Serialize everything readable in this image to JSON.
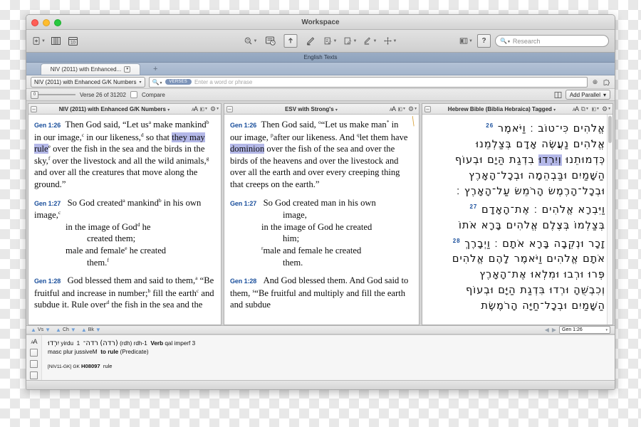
{
  "window": {
    "title": "Workspace",
    "traffic_lights": [
      "close",
      "minimize",
      "zoom"
    ]
  },
  "toolbar": {
    "left_icons": [
      "new-document-icon",
      "library-icon",
      "calendar-icon"
    ],
    "mid_icons": [
      "search-all-icon",
      "timeline-icon",
      "export-icon",
      "highlighter-icon",
      "notes-icon",
      "user-notes-icon",
      "edit-tool-icon",
      "move-icon"
    ],
    "right_icons": [
      "layout-icon",
      "help-icon"
    ],
    "research_placeholder": "Research",
    "magnifier": "search-icon"
  },
  "workspace": {
    "header_label": "English Texts",
    "tabs": [
      {
        "label": "NIV (2011) with Enhanced...",
        "has_menu": true
      }
    ],
    "add_tab_label": "+"
  },
  "search": {
    "corpus_label": "NIV (2011) with Enhanced G/K Numbers",
    "corpus_caret": "▾",
    "mode_pill": "VERSES",
    "placeholder": "Enter a word or phrase",
    "add_icon": "plus-circle-icon",
    "puzzle_icon": "puzzle-icon"
  },
  "verse_row": {
    "slider_value": "0",
    "verse_count_label": "Verse 26 of 31202",
    "compare_label": "Compare",
    "parallel_icon": "parallel-pane-icon",
    "add_parallel_label": "Add Parallel",
    "add_parallel_caret": "▾"
  },
  "panes": [
    {
      "id": "niv",
      "title": "NIV (2011) with Enhanced G/K Numbers",
      "title_caret": "▾",
      "tools": [
        "text-size-icon",
        "display-icon",
        "settings-icon"
      ],
      "verses": [
        {
          "ref": "Gen 1:26",
          "segments": [
            {
              "t": "Then God said, “Let us"
            },
            {
              "t": "a",
              "note": true
            },
            {
              "t": " make mankind"
            },
            {
              "t": "b",
              "note": true
            },
            {
              "t": " in our image,"
            },
            {
              "t": "c",
              "note": true
            },
            {
              "t": " in our likeness,"
            },
            {
              "t": "d",
              "note": true
            },
            {
              "t": " so that "
            },
            {
              "t": "they may rule",
              "hl": true
            },
            {
              "t": "e",
              "note": true
            },
            {
              "t": " over the fish in the sea and the birds in the sky,"
            },
            {
              "t": "f",
              "note": true
            },
            {
              "t": " over the livestock and all the wild animals,"
            },
            {
              "t": "g",
              "note": true
            },
            {
              "t": " and over all the creatures that move along the ground.”"
            }
          ]
        },
        {
          "ref": "Gen 1:27",
          "segments": [
            {
              "t": "So God created"
            },
            {
              "t": "a",
              "note": true
            },
            {
              "t": " mankind"
            },
            {
              "t": "b",
              "note": true
            },
            {
              "t": " in his own image,"
            },
            {
              "t": "c",
              "note": true
            },
            {
              "t": "in the image of God",
              "indent": 1
            },
            {
              "t": "d",
              "note": true
            },
            {
              "t": " he"
            },
            {
              "t": "created them;",
              "indent": 2
            },
            {
              "t": "male and female",
              "indent": 1
            },
            {
              "t": "e",
              "note": true
            },
            {
              "t": " he created"
            },
            {
              "t": "them.",
              "indent": 2
            },
            {
              "t": "f",
              "note": true
            }
          ]
        },
        {
          "ref": "Gen 1:28",
          "segments": [
            {
              "t": "God blessed them and said to them,"
            },
            {
              "t": "a",
              "note": true
            },
            {
              "t": " “Be fruitful and increase in number;"
            },
            {
              "t": "b",
              "note": true
            },
            {
              "t": " fill the earth"
            },
            {
              "t": "c",
              "note": true
            },
            {
              "t": " and subdue it. Rule over"
            },
            {
              "t": "d",
              "note": true
            },
            {
              "t": " the fish in the sea and the"
            }
          ]
        }
      ]
    },
    {
      "id": "esv",
      "title": "ESV with Strong's",
      "title_caret": "▾",
      "tools": [
        "text-size-icon",
        "display-icon",
        "settings-icon"
      ],
      "verses": [
        {
          "ref": "Gen 1:26",
          "segments": [
            {
              "t": "Then God said, "
            },
            {
              "t": "o",
              "note": true
            },
            {
              "t": "“Let us make man"
            },
            {
              "t": "*",
              "note": true
            },
            {
              "t": " in our image, "
            },
            {
              "t": "p",
              "note": true
            },
            {
              "t": "after our likeness. And "
            },
            {
              "t": "q",
              "note": true
            },
            {
              "t": "let them have "
            },
            {
              "t": "dominion",
              "hl": true
            },
            {
              "t": " over the fish of the sea and over the birds of the heavens and over the livestock and over all the earth and over every creeping thing that creeps on the earth.”"
            }
          ]
        },
        {
          "ref": "Gen 1:27",
          "segments": [
            {
              "t": "So God created man in his own"
            },
            {
              "t": "image,",
              "indent": 2
            },
            {
              "t": "in the image of God he created",
              "indent": 1
            },
            {
              "t": "him;",
              "indent": 2
            },
            {
              "t": "r",
              "note": true,
              "indent": 1
            },
            {
              "t": "male and female he created"
            },
            {
              "t": "them.",
              "indent": 2
            }
          ]
        },
        {
          "ref": "Gen 1:28",
          "segments": [
            {
              "t": "And God blessed them. And God said to them, "
            },
            {
              "t": "s",
              "note": true
            },
            {
              "t": "“Be fruitful and multiply and fill the earth and subdue"
            }
          ]
        }
      ]
    },
    {
      "id": "hebrew",
      "title": "Hebrew Bible (Biblia Hebraica) Tagged",
      "title_caret": "▾",
      "tools": [
        "copy-icon",
        "text-size-icon",
        "display-icon",
        "settings-icon"
      ],
      "lines": [
        {
          "verse": "26",
          "text": "אֱלֹהִים כִּי־טוֹב ׃ וַיֹּאמֶר"
        },
        {
          "verse": "",
          "text": "אֱלֹהִים נַעֲשֶׂה אָדָם בְּצַלְמֵנוּ"
        },
        {
          "verse": "",
          "text": "כִּדְמוּתֵנוּ וְיִרְדוּ בִדְגַת הַיָּם וּבְעוֹף",
          "highlight": "וְיִרְדוּ"
        },
        {
          "verse": "",
          "text": "הַשָּׁמַיִם וּבַּבְהֵמָה וּבְכָל־הָאָרֶץ"
        },
        {
          "verse": "",
          "text": "וּבְכָל־הָרֶמֶשׂ הָרֹמֵשׂ עַל־הָאָרֶץ ׃"
        },
        {
          "verse": "27",
          "text": "וַיִּבְרָא אֱלֹהִים ׃ אֶת־הָאָדָם"
        },
        {
          "verse": "",
          "text": "בְּצַלְמוֹ בְּצֶלֶם אֱלֹהִים בָּרָא אֹתוֹ"
        },
        {
          "verse": "28",
          "text": "זָכָר וּנְקֵבָה בָּרָא אֹתָם ׃ וַיְבָרֶךְ"
        },
        {
          "verse": "",
          "text": "אֹתָם אֱלֹהִים וַיֹּאמֶר לָהֶם אֱלֹהִים"
        },
        {
          "verse": "",
          "text": "פְּרוּ וּרְבוּ וּמִלְאוּ אֶת־הָאָרֶץ"
        },
        {
          "verse": "",
          "text": "וְכִבְשֻׁהָ וּרְדוּ בִּדְגַת הַיָּם וּבְעוֹף"
        },
        {
          "verse": "",
          "text": "הַשָּׁמַיִם וּבְכָל־חַיָּה הָרֹמֶשֶׂת"
        }
      ]
    }
  ],
  "nav": {
    "groups": [
      {
        "up": "▲",
        "label": "Vs",
        "down": "▼"
      },
      {
        "up": "▲",
        "label": "Ch",
        "down": "▼"
      },
      {
        "up": "▲",
        "label": "Bk",
        "down": "▼"
      }
    ],
    "prev_icon": "◀",
    "next_icon": "▶",
    "reference_value": "Gen 1:26",
    "reference_caret": "▾"
  },
  "details": {
    "gutter_icons": [
      "text-size-icon",
      "note-icon",
      "page-icon",
      "parallel-icon"
    ],
    "hebrew_word": "יִרְדוּ",
    "transliteration": "yirdu",
    "lemma_index": "1",
    "lemma_hebrew": "רדה־",
    "lemma_paren": "(רדה)",
    "lemma_translit": "(rdh)",
    "lemma_id": "rdh-1",
    "pos": "Verb",
    "parsing_1": "qal imperf 3",
    "parsing_2": "masc plur jussiveM",
    "gloss": "to rule",
    "function": "(Predicate)",
    "gk_tag": "[NIV11-GK]",
    "gk_label": "GK",
    "gk_number": "H08097",
    "gk_gloss": "rule"
  }
}
